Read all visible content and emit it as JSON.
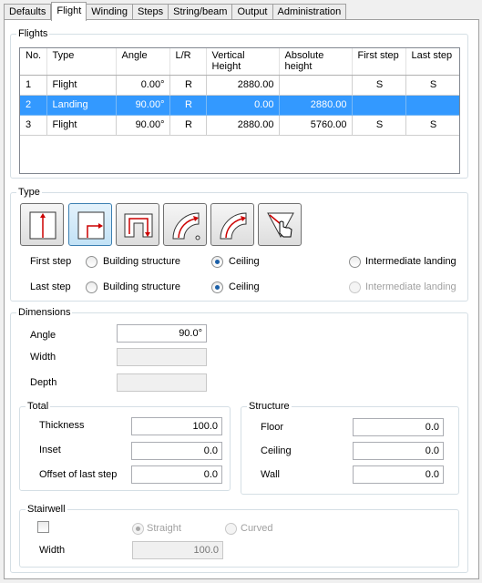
{
  "tabs": [
    "Defaults",
    "Flight",
    "Winding",
    "Steps",
    "String/beam",
    "Output",
    "Administration"
  ],
  "flights": {
    "title": "Flights",
    "columns": [
      "No.",
      "Type",
      "Angle",
      "L/R",
      "Vertical Height",
      "Absolute height",
      "First step",
      "Last step"
    ],
    "rows": [
      {
        "no": "1",
        "type": "Flight",
        "angle": "0.00°",
        "lr": "R",
        "vert": "2880.00",
        "abs": "",
        "first": "S",
        "last": "S"
      },
      {
        "no": "2",
        "type": "Landing",
        "angle": "90.00°",
        "lr": "R",
        "vert": "0.00",
        "abs": "2880.00",
        "first": "",
        "last": ""
      },
      {
        "no": "3",
        "type": "Flight",
        "angle": "90.00°",
        "lr": "R",
        "vert": "2880.00",
        "abs": "5760.00",
        "first": "S",
        "last": "S"
      }
    ]
  },
  "type": {
    "title": "Type",
    "buttons": [
      "straight-flight-icon",
      "quarter-landing-icon",
      "half-landing-icon",
      "winder-turn-icon",
      "curved-flight-icon",
      "pick-point-icon"
    ],
    "first_step_label": "First step",
    "last_step_label": "Last step",
    "opt_building": "Building structure",
    "opt_ceiling": "Ceiling",
    "opt_intermediate": "Intermediate landing"
  },
  "dimensions": {
    "title": "Dimensions",
    "angle_label": "Angle",
    "angle_value": "90.0°",
    "width_label": "Width",
    "depth_label": "Depth",
    "total": {
      "title": "Total",
      "thickness_label": "Thickness",
      "thickness_value": "100.0",
      "inset_label": "Inset",
      "inset_value": "0.0",
      "offset_label": "Offset of last step",
      "offset_value": "0.0"
    },
    "structure": {
      "title": "Structure",
      "floor_label": "Floor",
      "floor_value": "0.0",
      "ceiling_label": "Ceiling",
      "ceiling_value": "0.0",
      "wall_label": "Wall",
      "wall_value": "0.0"
    },
    "stairwell": {
      "title": "Stairwell",
      "straight_label": "Straight",
      "curved_label": "Curved",
      "width_label": "Width",
      "width_value": "100.0"
    }
  },
  "colors": {
    "selection": "#3399ff",
    "icon_red": "#cc0000"
  }
}
